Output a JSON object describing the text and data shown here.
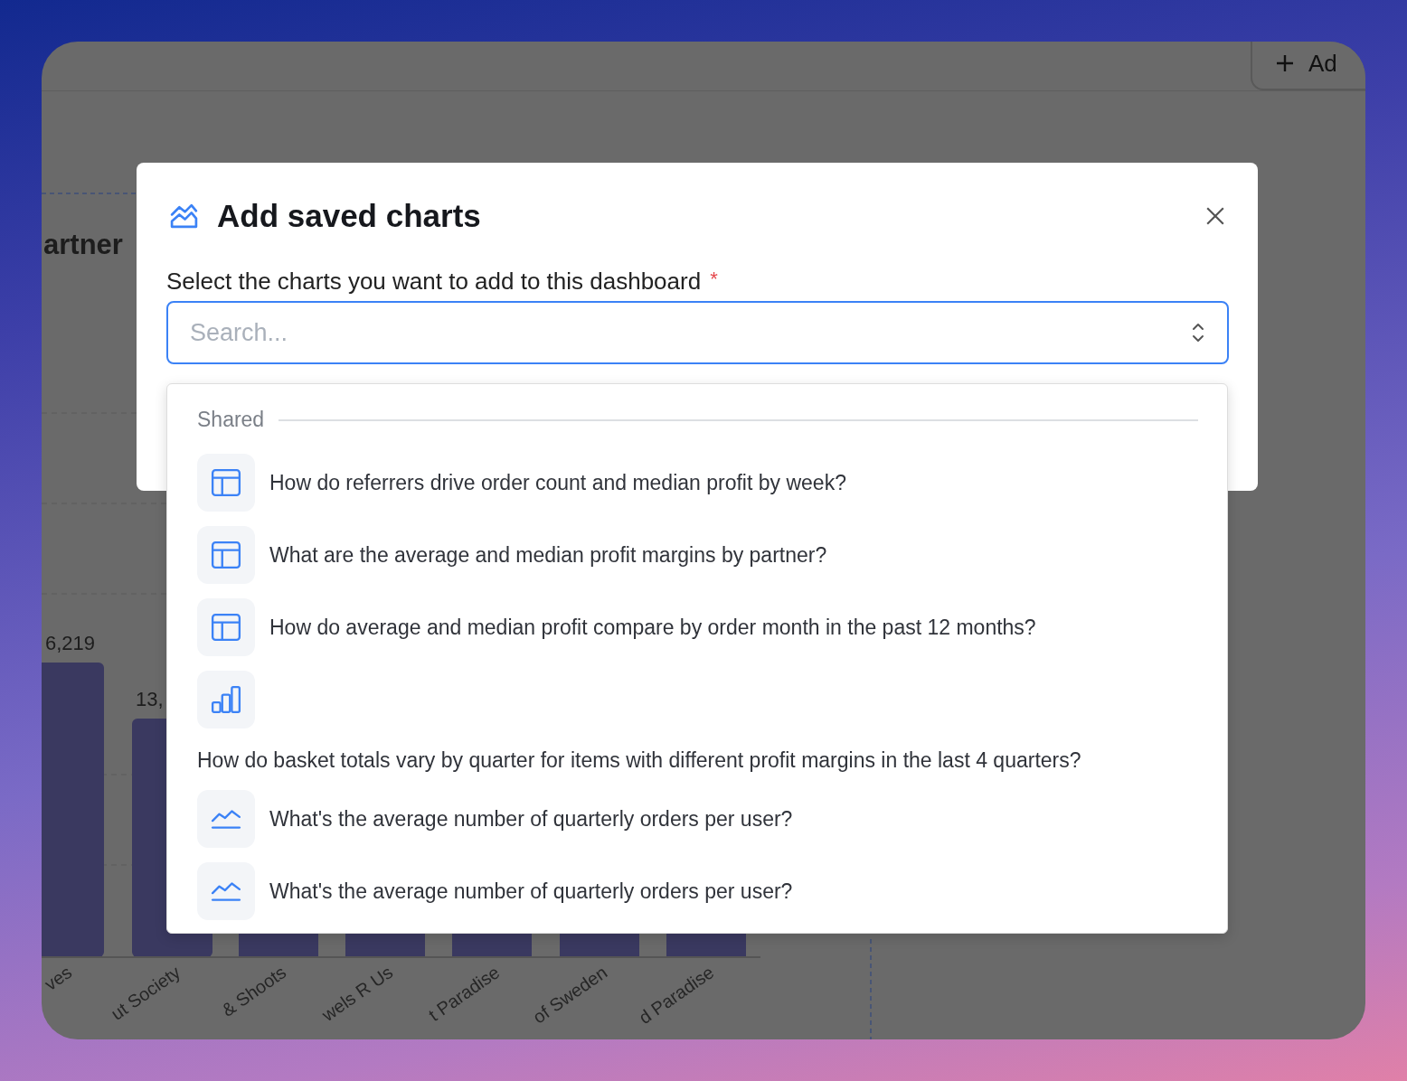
{
  "background": {
    "add_button": "Ad",
    "chart_title": "artner",
    "bar_values": [
      "6,219",
      "13,"
    ],
    "bar_labels": [
      "ves",
      "ut Society",
      "& Shoots",
      "wels R Us",
      "t Paradise",
      "of Sweden",
      "d Paradise"
    ]
  },
  "dialog": {
    "title": "Add saved charts",
    "field_label": "Select the charts you want to add to this dashboard",
    "required_mark": "*",
    "search": {
      "placeholder": "Search..."
    }
  },
  "dropdown": {
    "group": "Shared",
    "items": [
      {
        "kind": "table",
        "label": "How do referrers drive order count and median profit by week?"
      },
      {
        "kind": "table",
        "label": "What are the average and median profit margins by partner?"
      },
      {
        "kind": "table",
        "label": "How do average and median profit compare by order month in the past 12 months?"
      },
      {
        "kind": "bar",
        "label": "How do basket totals vary by quarter for items with different profit margins in the last 4 quarters?"
      },
      {
        "kind": "line",
        "label": "What's the average number of quarterly orders per user?"
      },
      {
        "kind": "line",
        "label": "What's the average number of quarterly orders per user?"
      }
    ]
  }
}
